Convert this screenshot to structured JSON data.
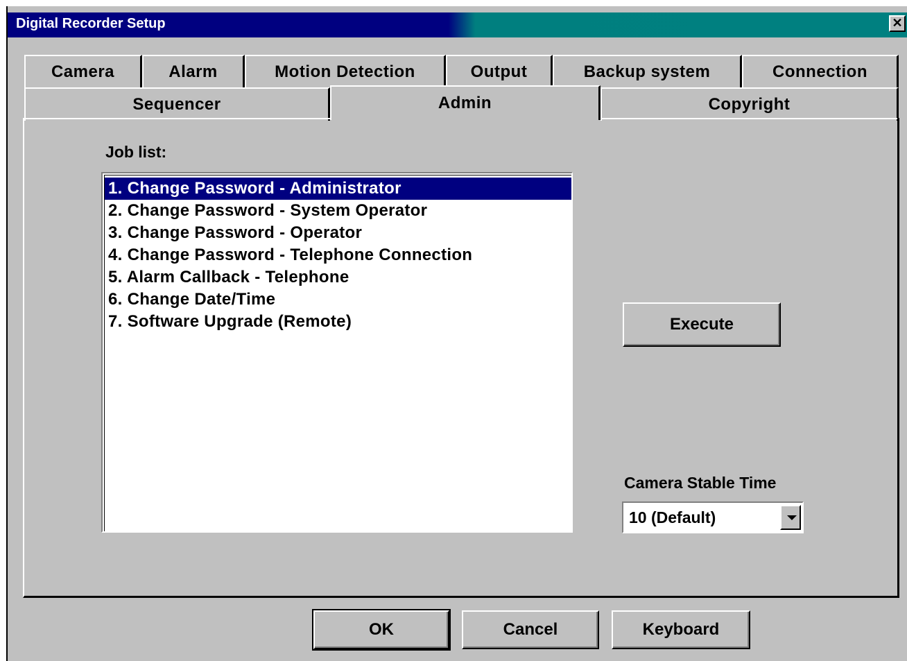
{
  "window": {
    "title": "Digital Recorder Setup",
    "close_label": "✕"
  },
  "tabs_row1": [
    {
      "label": "Camera"
    },
    {
      "label": "Alarm"
    },
    {
      "label": "Motion Detection"
    },
    {
      "label": "Output"
    },
    {
      "label": "Backup system"
    },
    {
      "label": "Connection"
    }
  ],
  "tabs_row2": [
    {
      "label": "Sequencer"
    },
    {
      "label": "Admin"
    },
    {
      "label": "Copyright"
    }
  ],
  "active_tab": "Admin",
  "admin": {
    "job_list_label": "Job list:",
    "jobs": [
      "1. Change Password - Administrator",
      "2. Change Password - System Operator",
      "3. Change Password - Operator",
      "4. Change Password - Telephone Connection",
      "5. Alarm Callback - Telephone",
      "6. Change Date/Time",
      "7. Software Upgrade (Remote)"
    ],
    "selected_index": 0,
    "execute_label": "Execute",
    "stable_time_label": "Camera Stable Time",
    "stable_time_value": "10 (Default)"
  },
  "footer": {
    "ok_label": "OK",
    "cancel_label": "Cancel",
    "keyboard_label": "Keyboard"
  },
  "colors": {
    "titlebar_start": "#000080",
    "titlebar_end": "#008080",
    "selection": "#000080",
    "face": "#c0c0c0"
  }
}
